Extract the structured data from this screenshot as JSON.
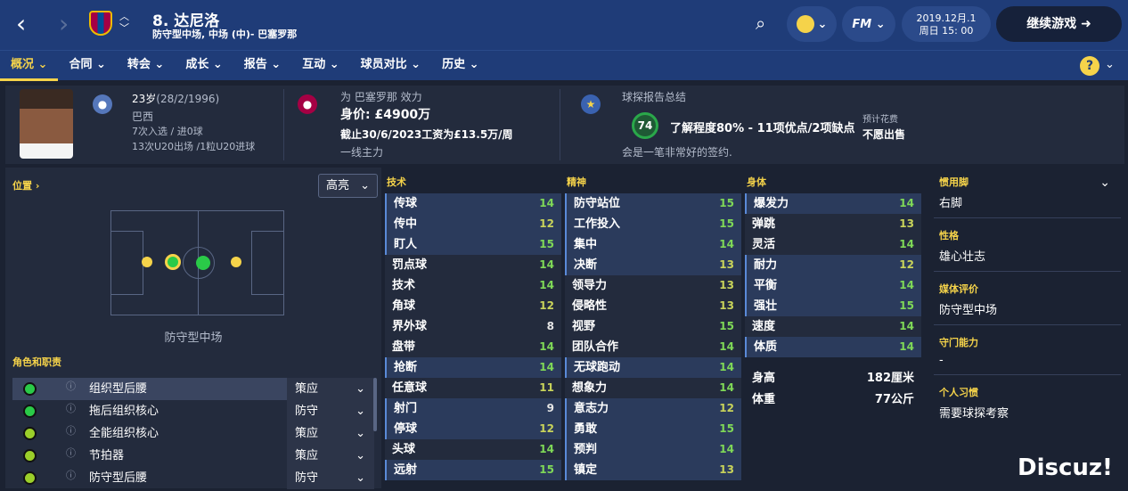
{
  "header": {
    "name": "8. 达尼洛",
    "positions": "防守型中场, 中场 (中)- 巴塞罗那",
    "date_line1": "2019.12月.1",
    "date_line2": "周日 15: 00",
    "continue": "继续游戏",
    "fm": "FM"
  },
  "tabs": [
    "概况",
    "合同",
    "转会",
    "成长",
    "报告",
    "互动",
    "球员对比",
    "历史"
  ],
  "info": {
    "age": "23岁",
    "birth": "(28/2/1996)",
    "nation": "巴西",
    "caps1": "7次入选 ",
    "caps2": "/ 进0球",
    "u20": "13次U20出场 /1粒U20进球",
    "club_for": "为 巴塞罗那 效力",
    "value": "身价: £4900万",
    "wage": "截止30/6/2023工资为£13.5万/周",
    "squad": "一线主力",
    "scout_title": "球探报告总结",
    "scout_score": "74",
    "scout_text": "了解程度80% - 11项优点/2项缺点",
    "scout_note": "会是一笔非常好的签约.",
    "fee_label": "预计花费",
    "fee_value": "不愿出售"
  },
  "left": {
    "position_label": "位置 ›",
    "highlight": "高亮",
    "role_name": "防守型中场",
    "roles_label": "角色和职责",
    "roles": [
      {
        "name": "组织型后腰",
        "duty": "策应"
      },
      {
        "name": "拖后组织核心",
        "duty": "防守"
      },
      {
        "name": "全能组织核心",
        "duty": "策应"
      },
      {
        "name": "节拍器",
        "duty": "策应"
      },
      {
        "name": "防守型后腰",
        "duty": "防守"
      }
    ]
  },
  "technical": {
    "title": "技术",
    "rows": [
      [
        "传球",
        "14"
      ],
      [
        "传中",
        "12"
      ],
      [
        "盯人",
        "15"
      ],
      [
        "罚点球",
        "14"
      ],
      [
        "技术",
        "14"
      ],
      [
        "角球",
        "12"
      ],
      [
        "界外球",
        "8"
      ],
      [
        "盘带",
        "14"
      ],
      [
        "抢断",
        "14"
      ],
      [
        "任意球",
        "11"
      ],
      [
        "射门",
        "9"
      ],
      [
        "停球",
        "12"
      ],
      [
        "头球",
        "14"
      ],
      [
        "远射",
        "15"
      ]
    ]
  },
  "mental": {
    "title": "精神",
    "rows": [
      [
        "防守站位",
        "15"
      ],
      [
        "工作投入",
        "15"
      ],
      [
        "集中",
        "14"
      ],
      [
        "决断",
        "13"
      ],
      [
        "领导力",
        "13"
      ],
      [
        "侵略性",
        "13"
      ],
      [
        "视野",
        "15"
      ],
      [
        "团队合作",
        "14"
      ],
      [
        "无球跑动",
        "14"
      ],
      [
        "想象力",
        "14"
      ],
      [
        "意志力",
        "12"
      ],
      [
        "勇敢",
        "15"
      ],
      [
        "预判",
        "14"
      ],
      [
        "镇定",
        "13"
      ]
    ]
  },
  "physical": {
    "title": "身体",
    "rows": [
      [
        "爆发力",
        "14"
      ],
      [
        "弹跳",
        "13"
      ],
      [
        "灵活",
        "14"
      ],
      [
        "耐力",
        "12"
      ],
      [
        "平衡",
        "14"
      ],
      [
        "强壮",
        "15"
      ],
      [
        "速度",
        "14"
      ],
      [
        "体质",
        "14"
      ]
    ],
    "height_label": "身高",
    "height": "182厘米",
    "weight_label": "体重",
    "weight": "77公斤"
  },
  "side": {
    "foot_label": "惯用脚",
    "foot": "右脚",
    "personality_label": "性格",
    "personality": "雄心壮志",
    "media_label": "媒体评价",
    "media": "防守型中场",
    "gk_label": "守门能力",
    "gk": "-",
    "habits_label": "个人习惯",
    "habits": "需要球探考察"
  },
  "watermark": "Discuz!"
}
